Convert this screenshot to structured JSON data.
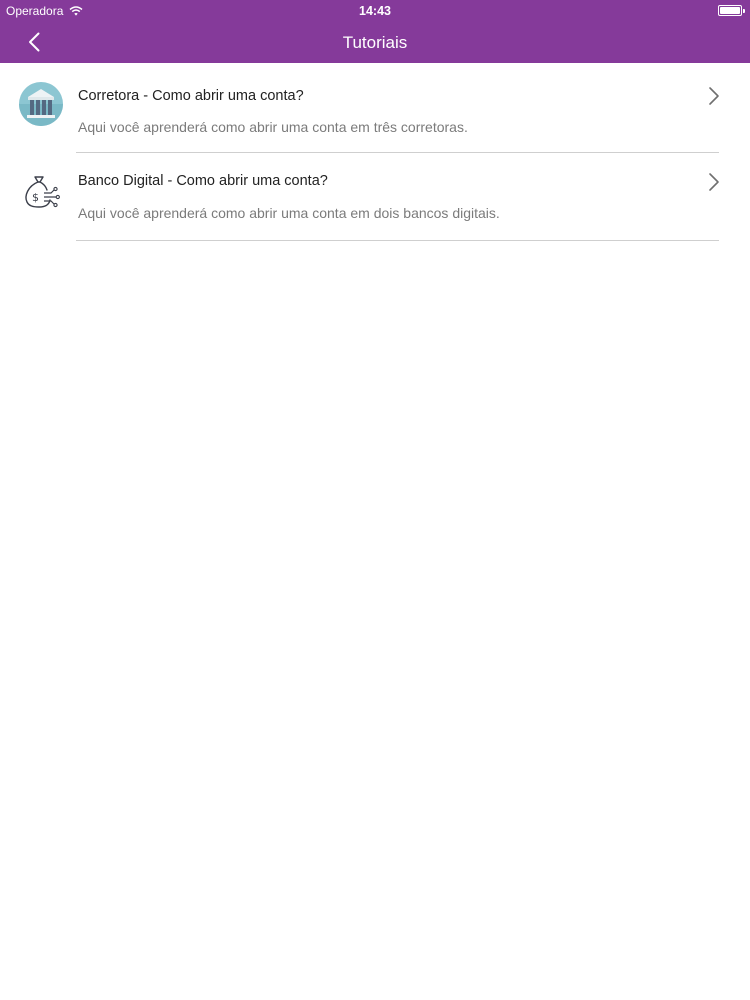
{
  "status_bar": {
    "carrier": "Operadora",
    "time": "14:43",
    "battery_level": 1.0
  },
  "nav": {
    "title": "Tutoriais",
    "back_icon": "chevron-left-icon",
    "bar_color": "#853a9a"
  },
  "tutorials": [
    {
      "icon": "bank-icon",
      "title": "Corretora - Como abrir uma conta?",
      "subtitle": "Aqui você aprenderá como abrir uma conta em três corretoras."
    },
    {
      "icon": "money-bag-icon",
      "title": "Banco Digital - Como abrir uma conta?",
      "subtitle": "Aqui você aprenderá como abrir uma conta em dois bancos digitais."
    }
  ]
}
